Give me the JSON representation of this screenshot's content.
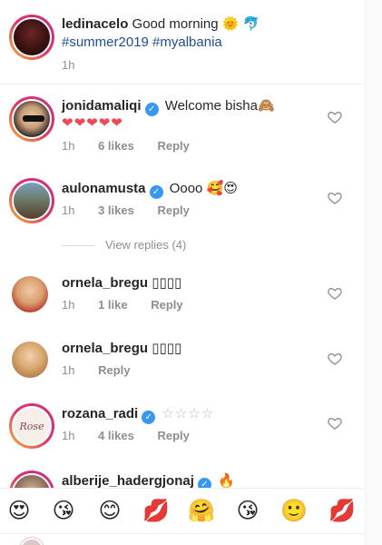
{
  "caption": {
    "username": "ledinacelo",
    "text": "Good morning 🌞 🐬",
    "hashtags": "#summer2019 #myalbania",
    "time": "1h"
  },
  "comments": [
    {
      "username": "jonidamaliqi",
      "verified": true,
      "text": "Welcome bisha🙈",
      "text2": "❤❤❤❤❤",
      "time": "1h",
      "likes": "6 likes",
      "reply": "Reply"
    },
    {
      "username": "aulonamusta",
      "verified": true,
      "text": "Oooo 🥰😍",
      "time": "1h",
      "likes": "3 likes",
      "reply": "Reply"
    },
    {
      "username": "ornela_bregu",
      "verified": false,
      "text": "▯▯▯▯",
      "time": "1h",
      "likes": "1 like",
      "reply": "Reply"
    },
    {
      "username": "ornela_bregu",
      "verified": false,
      "text": "▯▯▯▯",
      "time": "1h",
      "likes": "",
      "reply": "Reply"
    },
    {
      "username": "rozana_radi",
      "verified": true,
      "text": "☆☆☆☆",
      "time": "1h",
      "likes": "4 likes",
      "reply": "Reply"
    },
    {
      "username": "alberije_hadergjonaj",
      "verified": true,
      "text": "🔥"
    }
  ],
  "view_replies": "View replies (4)",
  "rozana_avatar_text": "Rose",
  "verified_mark": "✓",
  "emoji_bar": [
    "😍",
    "😘",
    "😊",
    "💋",
    "🤗",
    "😘",
    "🙂",
    "💋"
  ],
  "colors": {
    "verified": "#3897f0",
    "hashtag": "#1b4f94",
    "meta": "#8e8e8e"
  }
}
